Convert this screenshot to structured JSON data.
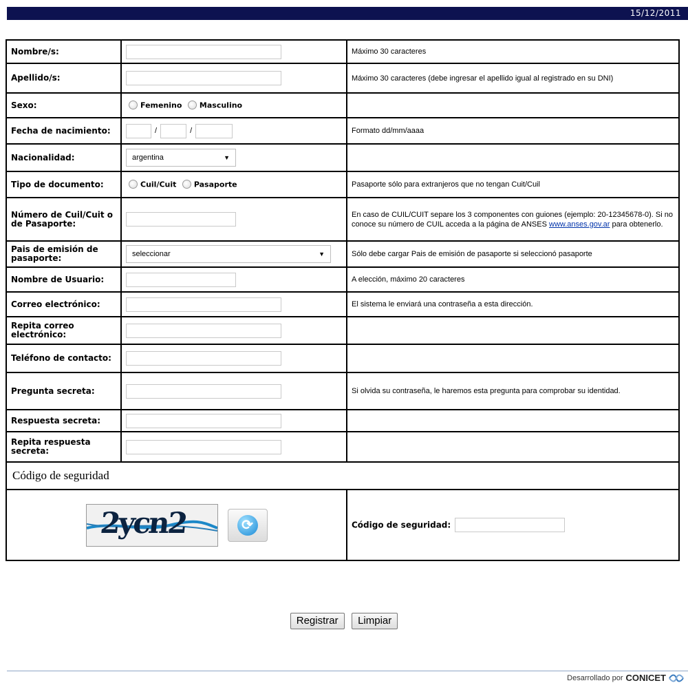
{
  "header": {
    "date": "15/12/2011"
  },
  "rows": [
    {
      "label": "Nombre/s:",
      "help": "Máximo 30 caracteres"
    },
    {
      "label": "Apellido/s:",
      "help": "Máximo 30 caracteres (debe ingresar el apellido igual al registrado en su DNI)"
    },
    {
      "label": "Sexo:",
      "options": [
        "Femenino",
        "Masculino"
      ]
    },
    {
      "label": "Fecha de nacimiento:",
      "separator": "/",
      "help": "Formato dd/mm/aaaa"
    },
    {
      "label": "Nacionalidad:",
      "selected": "argentina"
    },
    {
      "label": "Tipo de documento:",
      "options": [
        "Cuil/Cuit",
        "Pasaporte"
      ],
      "help": "Pasaporte sólo para extranjeros que no tengan Cuit/Cuil"
    },
    {
      "label": "Número de Cuil/Cuit o de Pasaporte:",
      "help_pre": "En caso de CUIL/CUIT separe los 3 componentes con guiones (ejemplo: 20-12345678-0). Si no conoce su número de CUIL acceda a la página de ANSES ",
      "help_link": "www.anses.gov.ar",
      "help_post": " para obtenerlo."
    },
    {
      "label": "Pais de emisión de pasaporte:",
      "selected": "seleccionar",
      "help": "Sólo debe cargar Pais de emisión de pasaporte si seleccionó pasaporte"
    },
    {
      "label": "Nombre de Usuario:",
      "help": "A elección, máximo 20 caracteres"
    },
    {
      "label": "Correo electrónico:",
      "help": "El sistema le enviará una contraseña a esta dirección."
    },
    {
      "label": "Repita correo electrónico:"
    },
    {
      "label": "Teléfono de contacto:"
    },
    {
      "label": "Pregunta secreta:",
      "help": "Si olvida su contraseña, le haremos esta pregunta para comprobar su identidad."
    },
    {
      "label": "Respuesta secreta:"
    },
    {
      "label": "Repita respuesta secreta:"
    }
  ],
  "captcha": {
    "section_title": "Código de seguridad",
    "image_text": "2ycn2",
    "refresh_icon": "refresh-icon",
    "field_label": "Código de seguridad:"
  },
  "buttons": {
    "submit": "Registrar",
    "clear": "Limpiar"
  },
  "footer": {
    "prefix": "Desarrollado por",
    "brand": "CONICET"
  }
}
